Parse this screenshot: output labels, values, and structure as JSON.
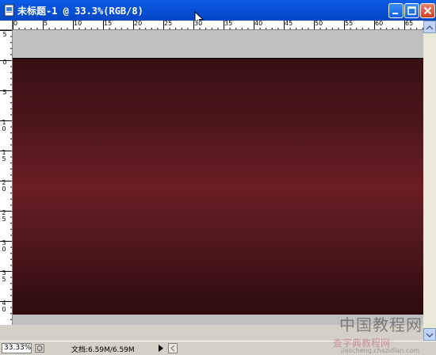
{
  "window": {
    "title": "未标题-1 @ 33.3%(RGB/8)",
    "title_bar_color": "#0852d6"
  },
  "ruler_top": {
    "labels": [
      "0",
      "5",
      "10",
      "15",
      "20",
      "25",
      "30",
      "35",
      "40",
      "45",
      "50",
      "55",
      "60",
      "65"
    ]
  },
  "ruler_left": {
    "labels": [
      "5",
      "0",
      "5",
      "10",
      "15",
      "20",
      "25",
      "30",
      "35",
      "40"
    ]
  },
  "canvas": {
    "fill_dark": "#371012",
    "fill_mid": "#6a1f24",
    "pasteboard_color": "#c0c0c0"
  },
  "status_bar": {
    "zoom": "33.33%",
    "doc_size": "文档:6.59M/6.59M"
  },
  "watermark": {
    "text": "中国教程网",
    "url": "查字典教程网",
    "url2": "jiaocheng.chazidian.com"
  },
  "icons": {
    "app": "photoshop-doc-icon",
    "minimize": "minimize-icon",
    "maximize": "maximize-icon",
    "close": "close-icon"
  }
}
